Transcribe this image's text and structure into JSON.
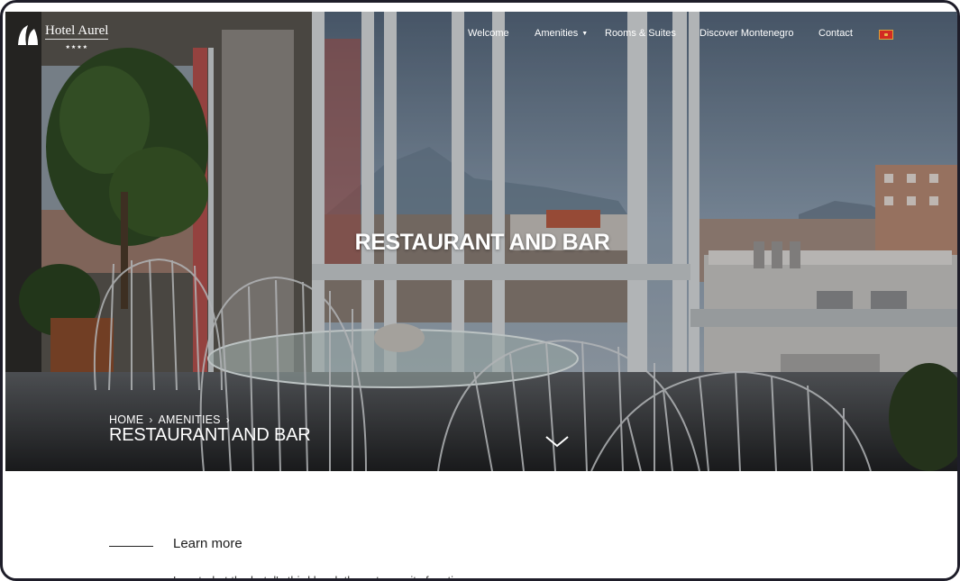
{
  "brand": {
    "name": "Hotel Aurel",
    "stars": "★★★★"
  },
  "nav": {
    "items": [
      {
        "label": "Welcome"
      },
      {
        "label": "Amenities"
      },
      {
        "label": "Rooms & Suites"
      },
      {
        "label": "Discover Montenegro"
      },
      {
        "label": "Contact"
      }
    ],
    "flag_color": "#d22b22"
  },
  "hero": {
    "title": "RESTAURANT AND BAR",
    "breadcrumb": [
      {
        "label": "HOME"
      },
      {
        "label": "AMENITIES"
      }
    ],
    "heading": "RESTAURANT AND BAR"
  },
  "content": {
    "learn_more": "Learn more",
    "body": "Located at the hotel's third level, these two units function"
  }
}
